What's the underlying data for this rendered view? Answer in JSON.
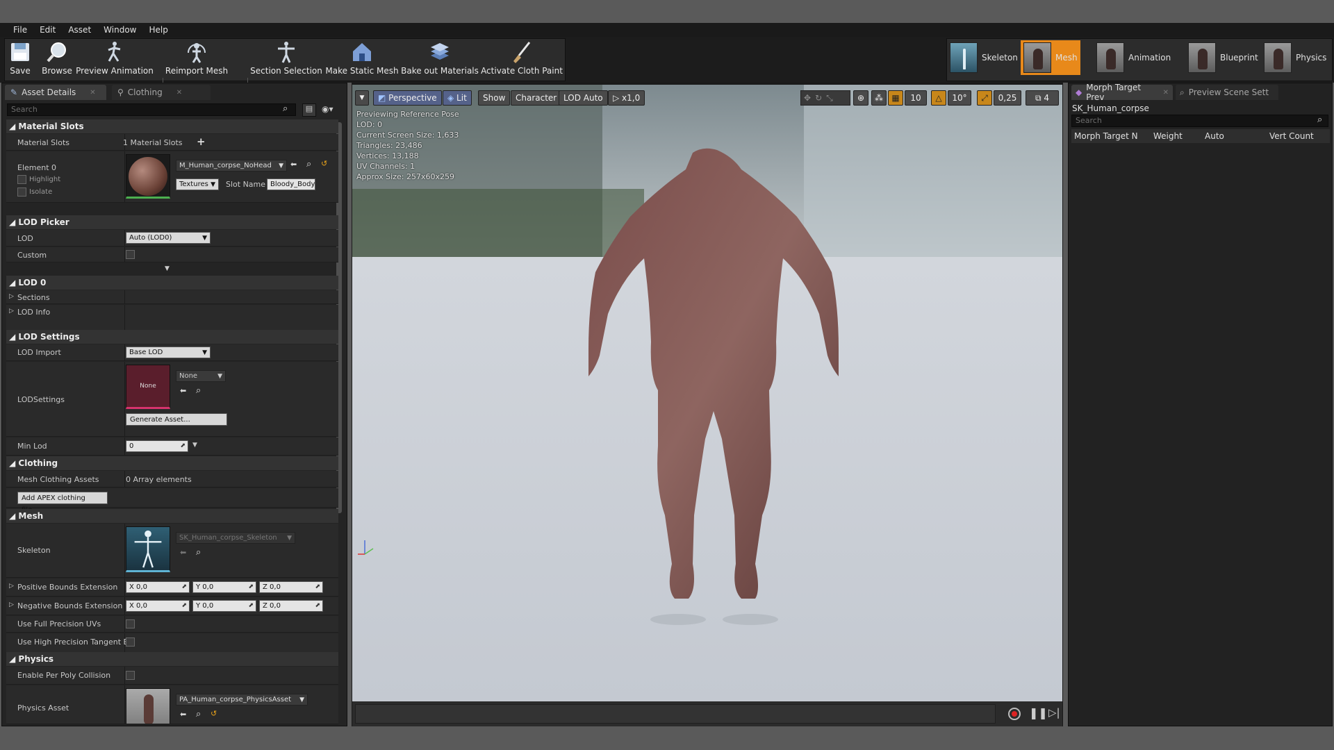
{
  "menu": [
    "File",
    "Edit",
    "Asset",
    "Window",
    "Help"
  ],
  "toolbar": {
    "save": "Save",
    "browse": "Browse",
    "preview_animation": "Preview Animation",
    "reimport_mesh": "Reimport Mesh",
    "section_selection": "Section Selection",
    "make_static_mesh": "Make Static Mesh",
    "bake_out_materials": "Bake out Materials",
    "activate_cloth_paint": "Activate Cloth Paint"
  },
  "modes": {
    "skeleton": "Skeleton",
    "mesh": "Mesh",
    "animation": "Animation",
    "blueprint": "Blueprint",
    "physics": "Physics"
  },
  "left_tabs": {
    "asset_details": "Asset Details",
    "clothing": "Clothing"
  },
  "details_search_placeholder": "Search",
  "material_slots": {
    "category": "Material Slots",
    "label": "Material Slots",
    "count": "1 Material Slots",
    "element": "Element 0",
    "highlight": "Highlight",
    "isolate": "Isolate",
    "material": "M_Human_corpse_NoHead",
    "textures": "Textures",
    "slot_name_label": "Slot Name",
    "slot_name_value": "Bloody_Body"
  },
  "lod_picker": {
    "category": "LOD Picker",
    "lod_label": "LOD",
    "lod_value": "Auto (LOD0)",
    "custom_label": "Custom"
  },
  "lod0": {
    "category": "LOD 0",
    "sections": "Sections",
    "lod_info": "LOD Info"
  },
  "lod_settings": {
    "category": "LOD Settings",
    "lod_import_label": "LOD Import",
    "lod_import_value": "Base LOD",
    "lodsettings_label": "LODSettings",
    "thumb_text": "None",
    "none_combo": "None",
    "generate_asset": "Generate Asset...",
    "min_lod_label": "Min Lod",
    "min_lod_value": "0"
  },
  "clothing": {
    "category": "Clothing",
    "mesh_clothing_assets": "Mesh Clothing Assets",
    "array_elements": "0 Array elements",
    "add_apex": "Add APEX clothing file..."
  },
  "mesh": {
    "category": "Mesh",
    "skeleton_label": "Skeleton",
    "skeleton_value": "SK_Human_corpse_Skeleton",
    "pos_bounds": "Positive Bounds Extension",
    "neg_bounds": "Negative Bounds Extension",
    "x": "X",
    "y": "Y",
    "z": "Z",
    "zero": "0,0",
    "full_precision_uvs": "Use Full Precision UVs",
    "high_precision_tangent": "Use High Precision Tangent B"
  },
  "physics": {
    "category": "Physics",
    "per_poly": "Enable Per Poly Collision",
    "asset_label": "Physics Asset",
    "asset_value": "PA_Human_corpse_PhysicsAsset"
  },
  "viewport": {
    "perspective": "Perspective",
    "lit": "Lit",
    "show": "Show",
    "character": "Character",
    "lod_auto": "LOD Auto",
    "speed": "x1,0",
    "grid_snap": "10",
    "rot_snap": "10°",
    "scale_snap": "0,25",
    "cam_speed": "4",
    "info": [
      "Previewing Reference Pose",
      "LOD: 0",
      "Current Screen Size: 1,633",
      "Triangles: 23,486",
      "Vertices: 13,188",
      "UV Channels: 1",
      "Approx Size: 257x60x259"
    ]
  },
  "right_tabs": {
    "morph": "Morph Target Prev",
    "scene": "Preview Scene Sett"
  },
  "morph": {
    "asset": "SK_Human_corpse",
    "search_placeholder": "Search",
    "col_name": "Morph Target N",
    "col_weight": "Weight",
    "col_auto": "Auto",
    "col_vert": "Vert Count"
  },
  "colors": {
    "mesh_mode_active": "#e8891a",
    "material_green": "#4caf50",
    "lod_thumb_red": "#5a1e2c"
  }
}
